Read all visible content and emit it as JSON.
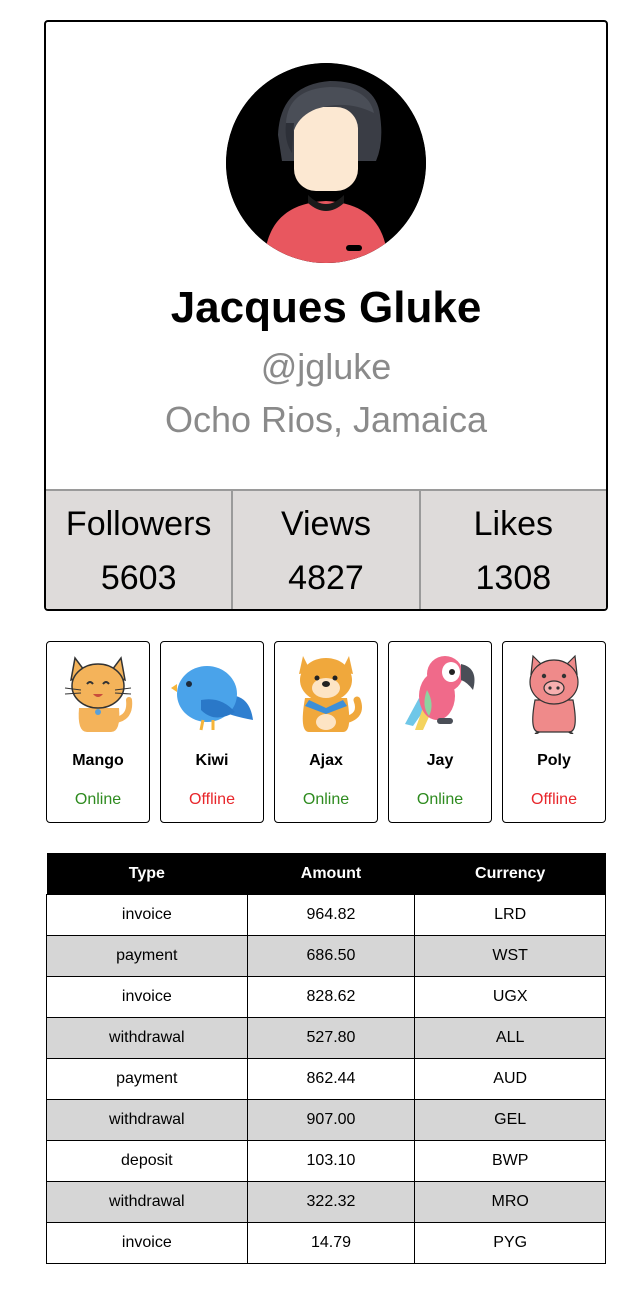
{
  "profile": {
    "name": "Jacques Gluke",
    "handle": "@jgluke",
    "location": "Ocho Rios, Jamaica",
    "avatar_icon": "user-avatar-icon"
  },
  "stats": [
    {
      "label": "Followers",
      "value": "5603"
    },
    {
      "label": "Views",
      "value": "4827"
    },
    {
      "label": "Likes",
      "value": "1308"
    }
  ],
  "pets": [
    {
      "name": "Mango",
      "status": "Online",
      "icon": "cat-icon"
    },
    {
      "name": "Kiwi",
      "status": "Offline",
      "icon": "bird-icon"
    },
    {
      "name": "Ajax",
      "status": "Online",
      "icon": "dog-icon"
    },
    {
      "name": "Jay",
      "status": "Online",
      "icon": "parrot-icon"
    },
    {
      "name": "Poly",
      "status": "Offline",
      "icon": "pig-icon"
    }
  ],
  "colors": {
    "online": "#2e8b1f",
    "offline": "#e8262b",
    "stats_bg": "#dedbda",
    "muted_text": "#8a8a8a"
  },
  "table": {
    "headers": [
      "Type",
      "Amount",
      "Currency"
    ],
    "rows": [
      [
        "invoice",
        "964.82",
        "LRD"
      ],
      [
        "payment",
        "686.50",
        "WST"
      ],
      [
        "invoice",
        "828.62",
        "UGX"
      ],
      [
        "withdrawal",
        "527.80",
        "ALL"
      ],
      [
        "payment",
        "862.44",
        "AUD"
      ],
      [
        "withdrawal",
        "907.00",
        "GEL"
      ],
      [
        "deposit",
        "103.10",
        "BWP"
      ],
      [
        "withdrawal",
        "322.32",
        "MRO"
      ],
      [
        "invoice",
        "14.79",
        "PYG"
      ]
    ]
  }
}
